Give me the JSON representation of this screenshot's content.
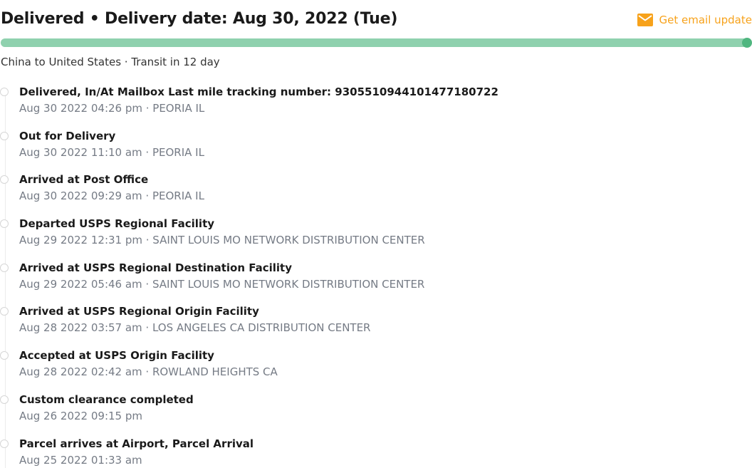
{
  "header": {
    "status_title": "Delivered • Delivery date: Aug 30, 2022 (Tue)",
    "email_label": "Get email update",
    "email_icon": "mail-icon",
    "accent_color": "#f7a21b"
  },
  "progress": {
    "fraction": 1.0,
    "fill_color": "#8fd1ae",
    "end_color": "#4fb67f"
  },
  "route": {
    "text": "China to United States · Transit in 12 day"
  },
  "events": [
    {
      "title": "Delivered, In/At Mailbox Last mile tracking number: 9305510944101477180722",
      "meta": "Aug 30 2022 04:26 pm · PEORIA IL"
    },
    {
      "title": "Out for Delivery",
      "meta": "Aug 30 2022 11:10 am · PEORIA IL"
    },
    {
      "title": "Arrived at Post Office",
      "meta": "Aug 30 2022 09:29 am · PEORIA IL"
    },
    {
      "title": "Departed USPS Regional Facility",
      "meta": "Aug 29 2022 12:31 pm · SAINT LOUIS MO NETWORK DISTRIBUTION CENTER"
    },
    {
      "title": "Arrived at USPS Regional Destination Facility",
      "meta": "Aug 29 2022 05:46 am · SAINT LOUIS MO NETWORK DISTRIBUTION CENTER"
    },
    {
      "title": "Arrived at USPS Regional Origin Facility",
      "meta": "Aug 28 2022 03:57 am · LOS ANGELES CA DISTRIBUTION CENTER"
    },
    {
      "title": "Accepted at USPS Origin Facility",
      "meta": "Aug 28 2022 02:42 am · ROWLAND HEIGHTS CA"
    },
    {
      "title": "Custom clearance completed",
      "meta": "Aug 26 2022 09:15 pm"
    },
    {
      "title": "Parcel arrives at Airport, Parcel Arrival",
      "meta": "Aug 25 2022 01:33 am"
    }
  ]
}
